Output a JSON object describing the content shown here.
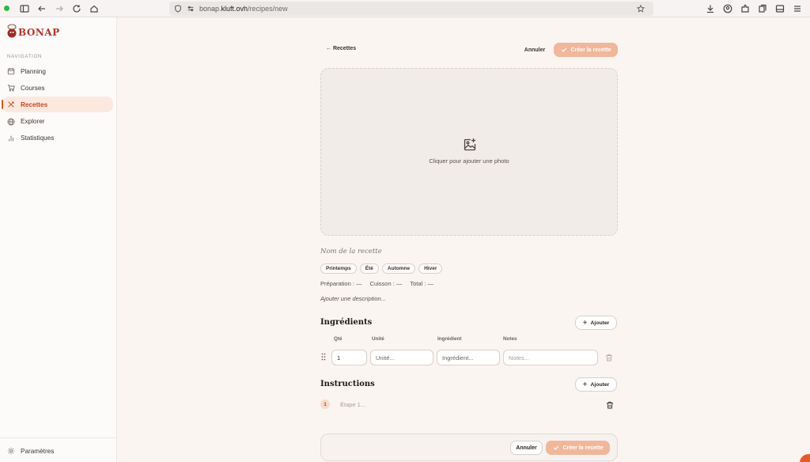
{
  "browser": {
    "url_prefix": "bonap.",
    "url_domain": "kluft.ovh",
    "url_path": "/recipes/new"
  },
  "app": {
    "logo_text": "BONAP"
  },
  "sidebar": {
    "heading": "NAVIGATION",
    "items": [
      {
        "label": "Planning",
        "icon": "calendar-icon"
      },
      {
        "label": "Courses",
        "icon": "cart-icon"
      },
      {
        "label": "Recettes",
        "icon": "utensils-icon",
        "active": true
      },
      {
        "label": "Explorer",
        "icon": "globe-icon"
      },
      {
        "label": "Statistiques",
        "icon": "bar-chart-icon"
      }
    ],
    "settings_label": "Paramètres"
  },
  "header": {
    "back_label": "← Recettes",
    "cancel_label": "Annuler",
    "create_label": "Créer la recette"
  },
  "photo": {
    "label": "Cliquer pour ajouter une photo"
  },
  "recipe": {
    "name_placeholder": "Nom de la recette",
    "seasons": [
      "Printemps",
      "Été",
      "Automne",
      "Hiver"
    ],
    "prep_label": "Préparation : —",
    "cook_label": "Cuisson : —",
    "total_label": "Total : —",
    "description_placeholder": "Ajouter une description..."
  },
  "ingredients": {
    "title": "Ingrédients",
    "add_label": "Ajouter",
    "columns": [
      "Qté",
      "Unité",
      "Ingrédient",
      "Notes"
    ],
    "row": {
      "qty": "1",
      "unit_placeholder": "Unité...",
      "ingredient_placeholder": "Ingrédient...",
      "notes_placeholder": "Notes..."
    }
  },
  "instructions": {
    "title": "Instructions",
    "add_label": "Ajouter",
    "step_number": "1",
    "step_placeholder": "Étape 1..."
  },
  "footer": {
    "cancel_label": "Annuler",
    "create_label": "Créer la recette"
  },
  "colors": {
    "accent": "#d85a2c",
    "create_button": "#f0b79b",
    "background": "#faf5f1"
  }
}
